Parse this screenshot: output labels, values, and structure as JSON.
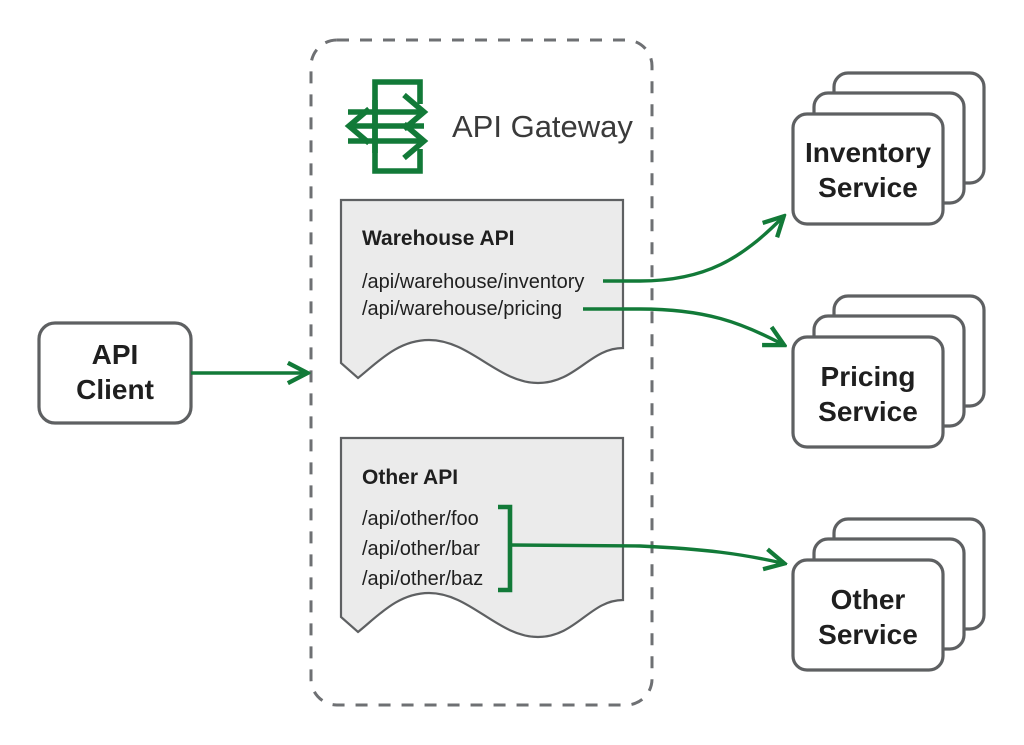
{
  "diagram": {
    "title": "API Gateway routing diagram",
    "colors": {
      "accent_green": "#127A38",
      "outline_gray": "#5e6062",
      "boundary_gray": "#6e7073",
      "doc_fill": "#ebebeb",
      "text_dark": "#1f1f1f",
      "background": "#ffffff"
    },
    "client": {
      "name": "API Client",
      "line1": "API",
      "line2": "Client"
    },
    "gateway": {
      "title": "API Gateway",
      "icon": "api-gateway-routing-icon",
      "documents": [
        {
          "id": "warehouse-api",
          "title": "Warehouse API",
          "paths": [
            "/api/warehouse/inventory",
            "/api/warehouse/pricing"
          ],
          "grouped": false
        },
        {
          "id": "other-api",
          "title": "Other API",
          "paths": [
            "/api/other/foo",
            "/api/other/bar",
            "/api/other/baz"
          ],
          "grouped": true
        }
      ]
    },
    "services": [
      {
        "id": "inventory-service",
        "line1": "Inventory",
        "line2": "Service",
        "stack_count": 3
      },
      {
        "id": "pricing-service",
        "line1": "Pricing",
        "line2": "Service",
        "stack_count": 3
      },
      {
        "id": "other-service",
        "line1": "Other",
        "line2": "Service",
        "stack_count": 3
      }
    ],
    "connections": [
      {
        "id": "client-to-gateway",
        "from": "API Client",
        "to": "API Gateway",
        "label": ""
      },
      {
        "id": "inventory-route",
        "from": "/api/warehouse/inventory",
        "to": "Inventory Service",
        "label": ""
      },
      {
        "id": "pricing-route",
        "from": "/api/warehouse/pricing",
        "to": "Pricing Service",
        "label": ""
      },
      {
        "id": "other-route",
        "from": "/api/other/*",
        "to": "Other Service",
        "label": ""
      }
    ]
  }
}
